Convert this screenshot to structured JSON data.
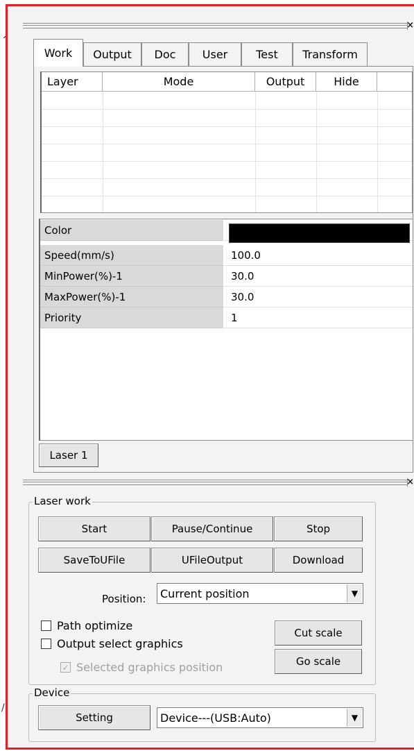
{
  "tabs": [
    "Work",
    "Output",
    "Doc",
    "User",
    "Test",
    "Transform"
  ],
  "layer_table": {
    "columns": [
      "Layer",
      "Mode",
      "Output",
      "Hide"
    ]
  },
  "properties": [
    {
      "name": "Color",
      "value": ""
    },
    {
      "name": "Speed(mm/s)",
      "value": "100.0"
    },
    {
      "name": "MinPower(%)-1",
      "value": "30.0"
    },
    {
      "name": "MaxPower(%)-1",
      "value": "30.0"
    },
    {
      "name": "Priority",
      "value": "1"
    }
  ],
  "color_swatch": "#000000",
  "laser_button": "Laser 1",
  "laser_work": {
    "label": "Laser work",
    "start": "Start",
    "pause": "Pause/Continue",
    "stop": "Stop",
    "save_to_ufile": "SaveToUFile",
    "ufile_output": "UFileOutput",
    "download": "Download",
    "position_label": "Position:",
    "position_value": "Current position",
    "path_optimize": "Path optimize",
    "output_select_graphics": "Output select graphics",
    "selected_graphics_position": "Selected graphics position",
    "cut_scale": "Cut scale",
    "go_scale": "Go scale"
  },
  "device": {
    "label": "Device",
    "setting": "Setting",
    "device_value": "Device---(USB:Auto)"
  },
  "icons": {
    "close": "×",
    "dropdown": "▼",
    "check": "✓"
  },
  "colors": {
    "frame_border": "#e81c25",
    "panel_bg": "#f3f3f3"
  }
}
